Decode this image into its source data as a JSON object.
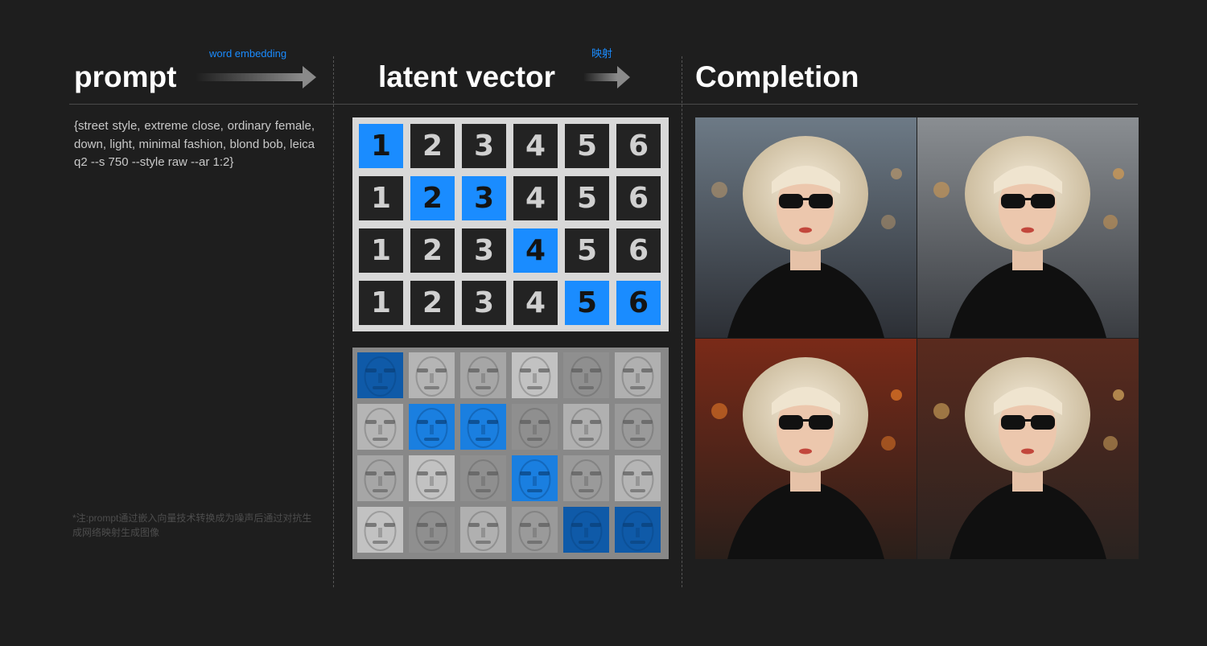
{
  "headings": {
    "prompt": "prompt",
    "latent": "latent vector",
    "completion": "Completion"
  },
  "hints": {
    "word_embedding": "word embedding",
    "mapping": "映射"
  },
  "prompt_text": "{street style, extreme close, ordinary female, down, light, minimal fashion, blond bob, leica q2 --s 750 --style raw --ar 1:2}",
  "note": "*注:prompt通过嵌入向量技术转换成为噪声后通过对抗生成网络映射生成图像",
  "number_grid": {
    "rows": [
      [
        "1",
        "2",
        "3",
        "4",
        "5",
        "6"
      ],
      [
        "1",
        "2",
        "3",
        "4",
        "5",
        "6"
      ],
      [
        "1",
        "2",
        "3",
        "4",
        "5",
        "6"
      ],
      [
        "1",
        "2",
        "3",
        "4",
        "5",
        "6"
      ]
    ],
    "highlighted": [
      [
        0
      ],
      [
        1,
        2
      ],
      [
        3
      ],
      [
        4,
        5
      ]
    ]
  },
  "face_grid": {
    "rows": 4,
    "cols": 6,
    "highlighted": [
      [
        0
      ],
      [
        1,
        2
      ],
      [
        3
      ],
      [
        4,
        5
      ]
    ]
  },
  "completion_images": [
    "woman-blond-bob-sunglasses-1",
    "woman-blond-bob-sunglasses-2",
    "woman-blond-bob-sunglasses-3",
    "woman-blond-bob-sunglasses-4"
  ],
  "colors": {
    "accent": "#1a8cff",
    "background": "#1e1e1e"
  }
}
